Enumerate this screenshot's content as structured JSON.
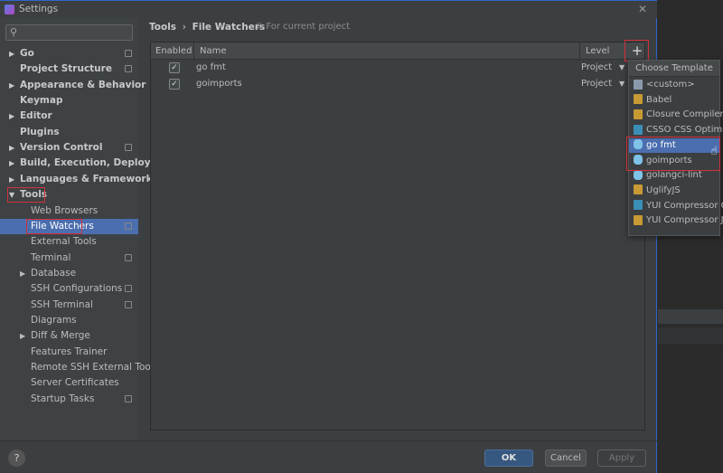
{
  "window": {
    "title": "Settings",
    "close_icon": "close-icon"
  },
  "search": {
    "placeholder": ""
  },
  "sidebar": {
    "items": [
      {
        "label": "Go",
        "bold": true,
        "arrow": true,
        "proj": true
      },
      {
        "label": "Project Structure",
        "bold": true,
        "proj": true
      },
      {
        "label": "Appearance & Behavior",
        "bold": true,
        "arrow": true
      },
      {
        "label": "Keymap",
        "bold": true
      },
      {
        "label": "Editor",
        "bold": true,
        "arrow": true
      },
      {
        "label": "Plugins",
        "bold": true
      },
      {
        "label": "Version Control",
        "bold": true,
        "arrow": true,
        "proj": true
      },
      {
        "label": "Build, Execution, Deployment",
        "bold": true,
        "arrow": true
      },
      {
        "label": "Languages & Frameworks",
        "bold": true,
        "arrow": true
      },
      {
        "label": "Tools",
        "bold": true,
        "arrow": true,
        "expanded": true
      },
      {
        "label": "Web Browsers",
        "indent": 1
      },
      {
        "label": "File Watchers",
        "indent": 1,
        "selected": true,
        "proj": true
      },
      {
        "label": "External Tools",
        "indent": 1
      },
      {
        "label": "Terminal",
        "indent": 1,
        "proj": true
      },
      {
        "label": "Database",
        "indent": 1,
        "arrow": true
      },
      {
        "label": "SSH Configurations",
        "indent": 1,
        "proj": true
      },
      {
        "label": "SSH Terminal",
        "indent": 1,
        "proj": true
      },
      {
        "label": "Diagrams",
        "indent": 1
      },
      {
        "label": "Diff & Merge",
        "indent": 1,
        "arrow": true
      },
      {
        "label": "Features Trainer",
        "indent": 1
      },
      {
        "label": "Remote SSH External Tools",
        "indent": 1
      },
      {
        "label": "Server Certificates",
        "indent": 1
      },
      {
        "label": "Startup Tasks",
        "indent": 1,
        "proj": true
      }
    ]
  },
  "breadcrumb": {
    "parent": "Tools",
    "separator": "›",
    "current": "File Watchers",
    "scope": "For current project"
  },
  "table": {
    "headers": {
      "enabled": "Enabled",
      "name": "Name",
      "level": "Level"
    },
    "rows": [
      {
        "enabled": true,
        "name": "go fmt",
        "level": "Project"
      },
      {
        "enabled": true,
        "name": "goimports",
        "level": "Project"
      }
    ],
    "add_label": "+"
  },
  "popup": {
    "title": "Choose Template",
    "items": [
      {
        "label": "<custom>",
        "icon": "custom-icon",
        "color": "#8a9aaa"
      },
      {
        "label": "Babel",
        "icon": "js-icon",
        "color": "#c79a34"
      },
      {
        "label": "Closure Compiler",
        "icon": "js-icon",
        "color": "#c79a34"
      },
      {
        "label": "CSSO CSS Optimizer",
        "icon": "css-icon",
        "color": "#3a8fb7"
      },
      {
        "label": "go fmt",
        "icon": "gopher-icon",
        "color": "#7fc3e8",
        "selected": true
      },
      {
        "label": "goimports",
        "icon": "gopher-icon",
        "color": "#7fc3e8"
      },
      {
        "label": "golangci-lint",
        "icon": "gopher-icon",
        "color": "#7fc3e8"
      },
      {
        "label": "UglifyJS",
        "icon": "js-icon",
        "color": "#c79a34"
      },
      {
        "label": "YUI Compressor CSS",
        "icon": "css-icon",
        "color": "#3a8fb7"
      },
      {
        "label": "YUI Compressor JS",
        "icon": "js-icon",
        "color": "#c79a34"
      }
    ]
  },
  "buttons": {
    "help": "?",
    "ok": "OK",
    "cancel": "Cancel",
    "apply": "Apply"
  },
  "colors": {
    "selection": "#4b6eaf",
    "highlight": "#d2313b",
    "primary_button": "#365880"
  }
}
